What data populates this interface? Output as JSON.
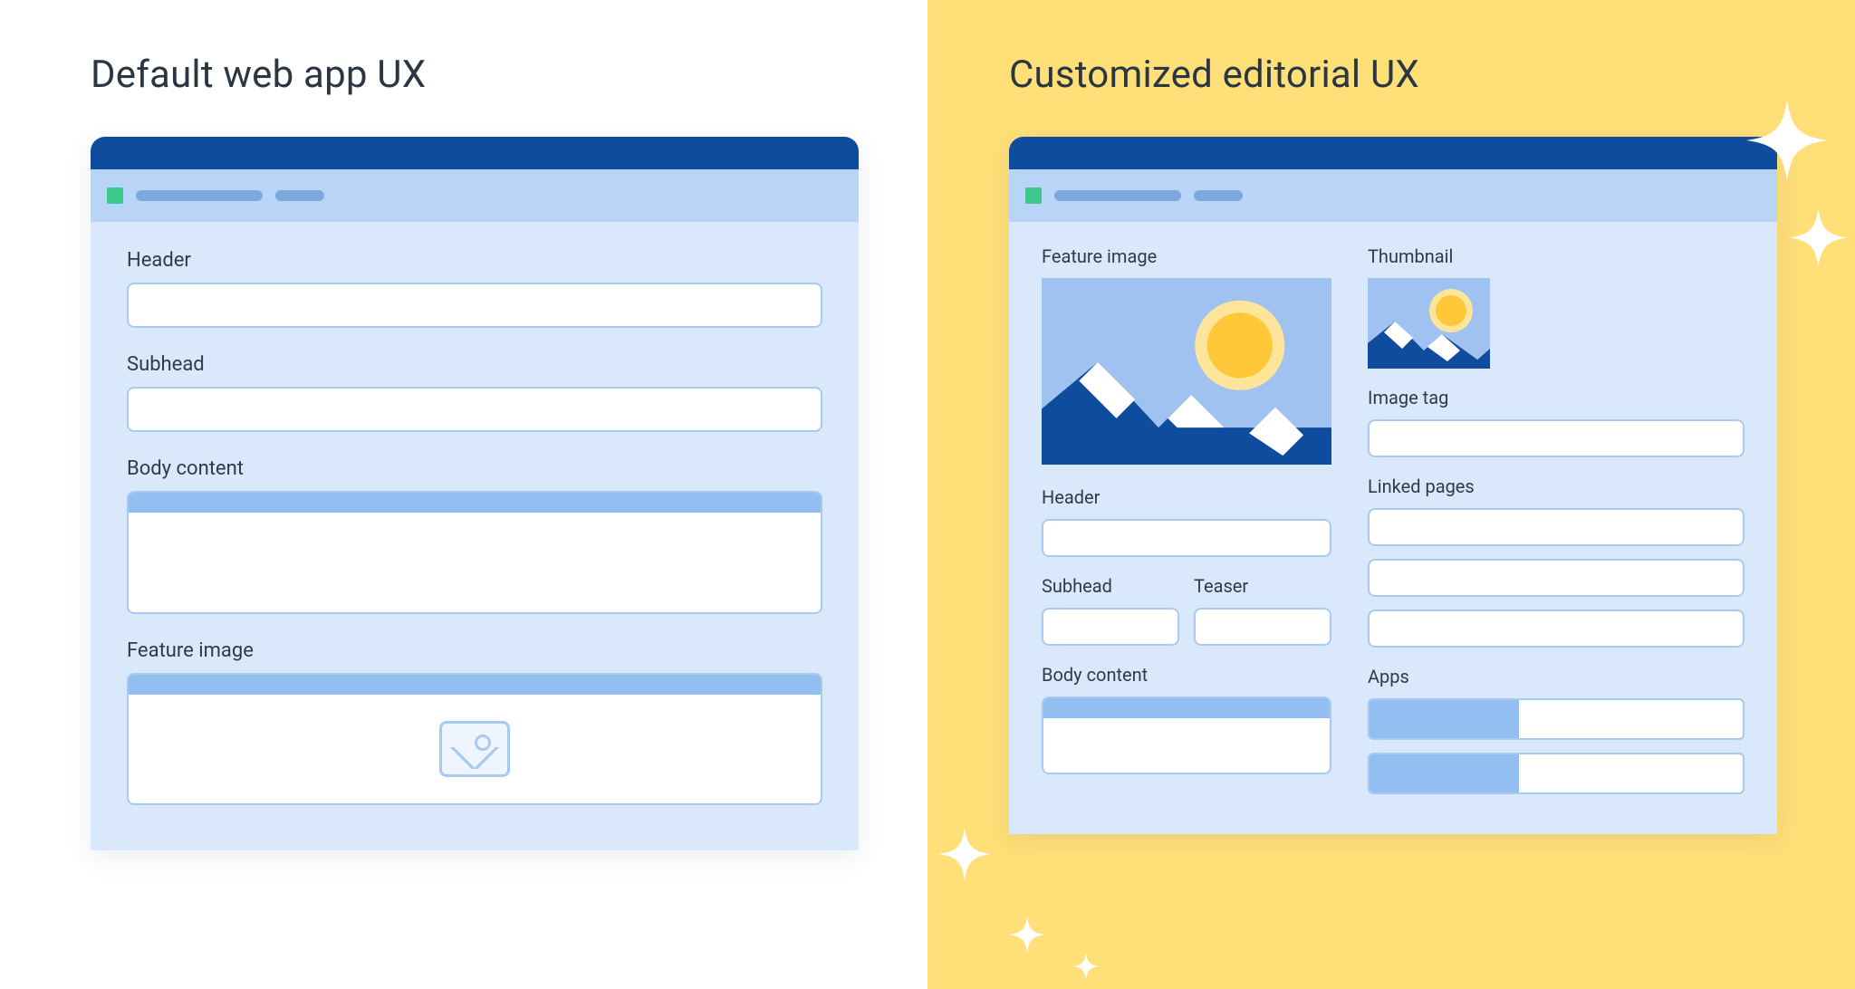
{
  "left": {
    "title": "Default web app UX",
    "fields": {
      "header": "Header",
      "subhead": "Subhead",
      "body": "Body content",
      "feature_image": "Feature image"
    }
  },
  "right": {
    "title": "Customized editorial UX",
    "fields": {
      "feature_image": "Feature image",
      "thumbnail": "Thumbnail",
      "image_tag": "Image tag",
      "header": "Header",
      "linked_pages": "Linked pages",
      "subhead": "Subhead",
      "teaser": "Teaser",
      "body": "Body content",
      "apps": "Apps"
    }
  }
}
